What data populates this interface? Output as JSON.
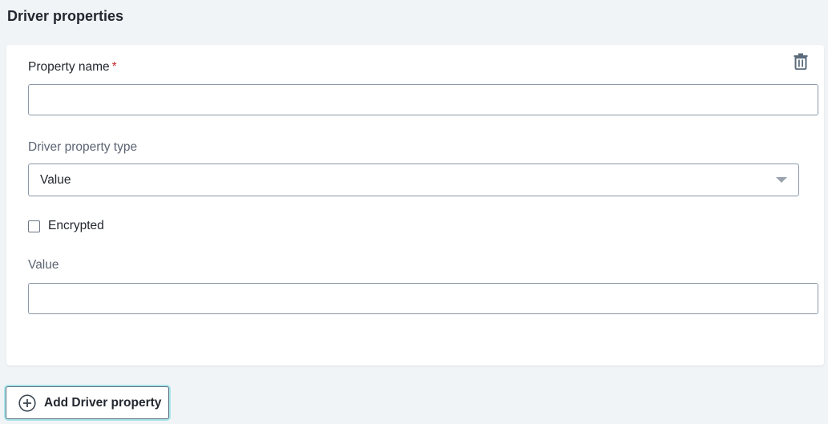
{
  "section": {
    "title": "Driver properties"
  },
  "property_card": {
    "property_name": {
      "label": "Property name",
      "required_marker": "*",
      "value": ""
    },
    "driver_property_type": {
      "label": "Driver property type",
      "selected": "Value"
    },
    "encrypted": {
      "label": "Encrypted",
      "checked": false
    },
    "value_field": {
      "label": "Value",
      "value": ""
    },
    "delete_icon": "trash-icon"
  },
  "add_button": {
    "label": "Add Driver property",
    "icon": "plus-circle-icon"
  },
  "colors": {
    "page_background": "#f1f4f7",
    "card_background": "#ffffff",
    "required": "#c62828",
    "focus_ring": "#a8e6ea",
    "text": "#23272f",
    "secondary_text": "#5b6472"
  }
}
